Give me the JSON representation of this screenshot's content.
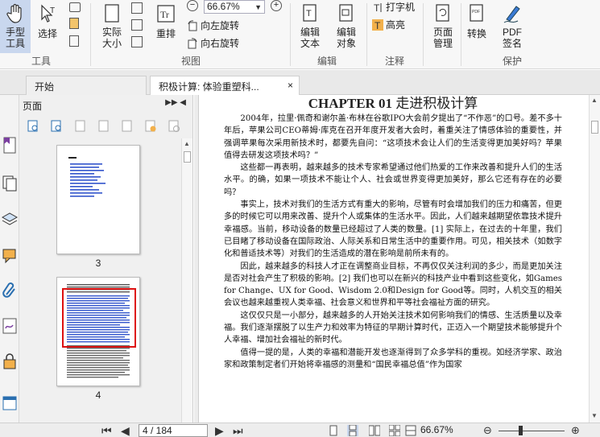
{
  "ribbon": {
    "hand_tool": "手型\n工具",
    "select": "选择",
    "actual_size": "实际\n大小",
    "reflow": "重排",
    "zoom_value": "66.67%",
    "rotate_left": "向左旋转",
    "rotate_right": "向右旋转",
    "edit_text": "编辑\n文本",
    "edit_object": "编辑\n对象",
    "typewriter": "打字机",
    "highlight": "高亮",
    "page_manage": "页面\n管理",
    "convert": "转换",
    "pdf_sign": "PDF\n签名",
    "groups": {
      "tools": "工具",
      "view": "视图",
      "edit": "编辑",
      "comment": "注释",
      "protect": "保护"
    }
  },
  "tabs": [
    {
      "label": "开始"
    },
    {
      "label": "积极计算: 体验重塑科...",
      "close": "×"
    }
  ],
  "panel": {
    "title": "页面",
    "controls": "▶▶ ◀",
    "thumbnails": [
      {
        "page": "3"
      },
      {
        "page": "4"
      }
    ]
  },
  "document": {
    "chapter_label": "CHAPTER 01",
    "chapter_title": "走进积极计算",
    "paragraphs": [
      "2004年，拉里·佩奇和谢尔盖·布林在谷歌IPO大会前夕提出了“不作恶”的口号。差不多十年后，苹果公司CEO蒂姆·库克在召开年度开发者大会时，着重关注了情感体验的重要性，并强调苹果每次采用新技术时，都要先自问：“这项技术会让人们的生活变得更加美好吗？苹果值得去研发这项技术吗？”",
      "这些都一再表明，越来越多的技术专家希望通过他们热爱的工作来改善和提升人们的生活水平。的确，如果一项技术不能让个人、社会或世界变得更加美好，那么它还有存在的必要吗？",
      "事实上，技术对我们的生活方式有重大的影响，尽管有时会增加我们的压力和痛苦，但更多的时候它可以用来改善、提升个人或集体的生活水平。因此，人们越来越期望依靠技术提升幸福感。当前，移动设备的数量已经超过了人类的数量。[1] 实际上，在过去的十年里，我们已目睹了移动设备在国际政治、人际关系和日常生活中的重要作用。可见，相关技术（如数字化和普适技术等）对我们的生活造成的潜在影响是前所未有的。",
      "因此，越来越多的科技人才正在调整商业目标，不再仅仅关注利润的多少，而是更加关注是否对社会产生了积极的影响。[2] 我们也可以在新兴的科技产业中看到这些变化，如Games for Change、UX for Good、Wisdom 2.0和Design for Good等。同时，人机交互的相关会议也越来越重视人类幸福、社会意义和世界和平等社会福祉方面的研究。",
      "这仅仅只是一小部分，越来越多的人开始关注技术如何影响我们的情感、生活质量以及幸福。我们逐渐摆脱了以生产力和效率为特征的早期计算时代，正迈入一个期望技术能够提升个人幸福、增加社会福祉的新时代。",
      "值得一提的是，人类的幸福和潜能开发也逐渐得到了众多学科的重视。如经济学家、政治家和政策制定者们开始将幸福感的测量和“国民幸福总值”作为国家"
    ]
  },
  "status": {
    "page_display": "4 / 184",
    "zoom": "66.67%"
  }
}
